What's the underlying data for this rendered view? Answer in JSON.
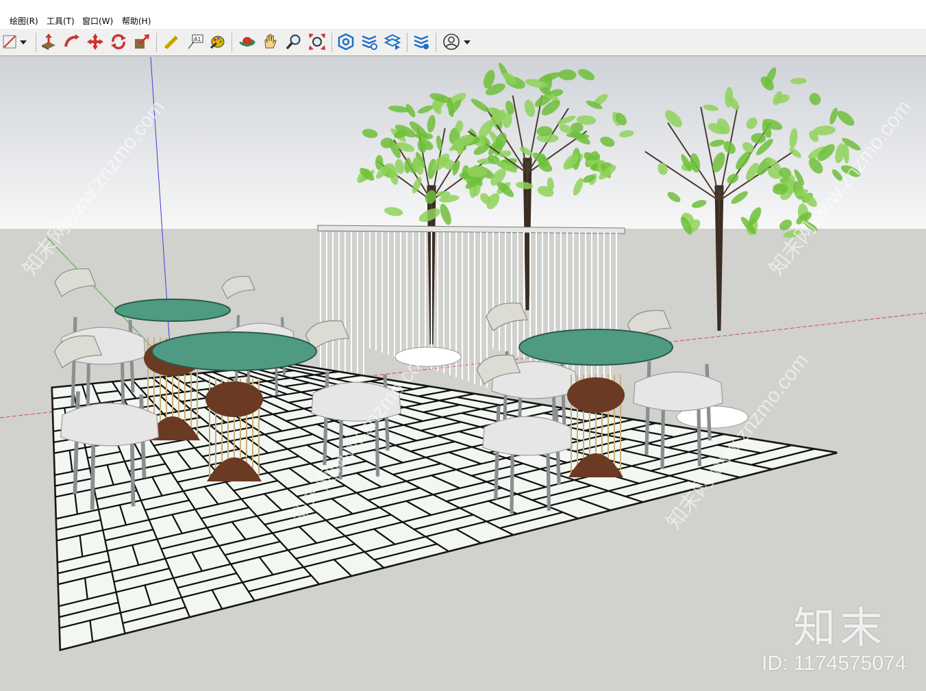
{
  "menu": {
    "draw": "绘图(R)",
    "tools": "工具(T)",
    "window": "窗口(W)",
    "help": "帮助(H)"
  },
  "toolbar": {
    "icons": [
      "line-icon",
      "dropdown-arrow-icon",
      "push-pull-icon",
      "follow-me-icon",
      "move-icon",
      "rotate-icon",
      "scale-icon",
      "tape-measure-icon",
      "text-icon",
      "paint-bucket-icon",
      "orbit-icon",
      "pan-icon",
      "zoom-icon",
      "zoom-extents-icon",
      "warehouse-icon",
      "extension-icon",
      "layers-icon",
      "extension-manager-icon",
      "account-icon",
      "account-dropdown-icon"
    ]
  },
  "colors": {
    "sky_top": "#cfd3d8",
    "sky_bottom": "#f7f7f8",
    "ground": "#d1d1ce",
    "table_top": "#4f9a82",
    "tile_fill": "#f2f7f2",
    "tile_line": "#111111",
    "foliage": "#6fbf3a",
    "seat": "#e6e6e6",
    "frame": "#8b8f90",
    "axis_red": "#d24a4a",
    "axis_green": "#3fae3f",
    "axis_blue": "#3b3bd6"
  },
  "watermark": {
    "brand": "知末",
    "id": "ID: 1174575074",
    "diagonal": "知末网www.znzmo.com"
  }
}
